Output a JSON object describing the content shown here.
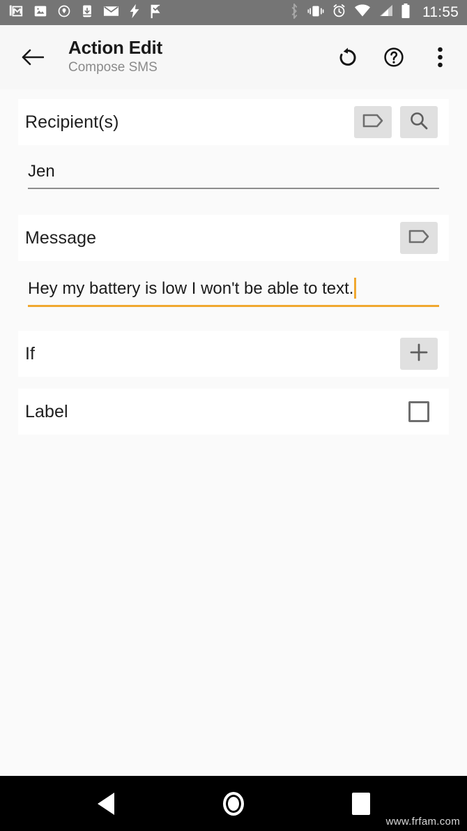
{
  "status_bar": {
    "time": "11:55",
    "background_color": "#757575",
    "left_icons": [
      {
        "name": "gmail-icon"
      },
      {
        "name": "photos-icon"
      },
      {
        "name": "location-pin-icon"
      },
      {
        "name": "app-download-icon"
      },
      {
        "name": "mail-icon"
      },
      {
        "name": "lightning-bolt-icon"
      },
      {
        "name": "tasker-flag-icon"
      }
    ],
    "right_icons": [
      {
        "name": "bluetooth-icon"
      },
      {
        "name": "vibrate-icon"
      },
      {
        "name": "alarm-clock-icon"
      },
      {
        "name": "wifi-icon"
      },
      {
        "name": "cell-signal-icon"
      },
      {
        "name": "battery-icon"
      }
    ]
  },
  "toolbar": {
    "title": "Action Edit",
    "subtitle": "Compose SMS",
    "back_label": "Back",
    "reset_label": "Reset",
    "help_label": "Help",
    "overflow_label": "More options"
  },
  "form": {
    "accent_color": "#f0a830",
    "rows": [
      {
        "id": "recipients",
        "label": "Recipient(s)",
        "actions": [
          "tag-icon",
          "search-icon"
        ],
        "value": "Jen",
        "focused": false
      },
      {
        "id": "message",
        "label": "Message",
        "actions": [
          "tag-icon"
        ],
        "value": "Hey my battery is low I won't be able to text.",
        "focused": true
      },
      {
        "id": "if",
        "label": "If",
        "actions": [
          "plus-icon"
        ]
      },
      {
        "id": "label",
        "label": "Label",
        "actions": [
          "checkbox"
        ],
        "checked": false
      }
    ]
  },
  "nav_bar": {
    "back_label": "Back",
    "home_label": "Home",
    "recents_label": "Recents",
    "watermark": "www.frfam.com"
  }
}
